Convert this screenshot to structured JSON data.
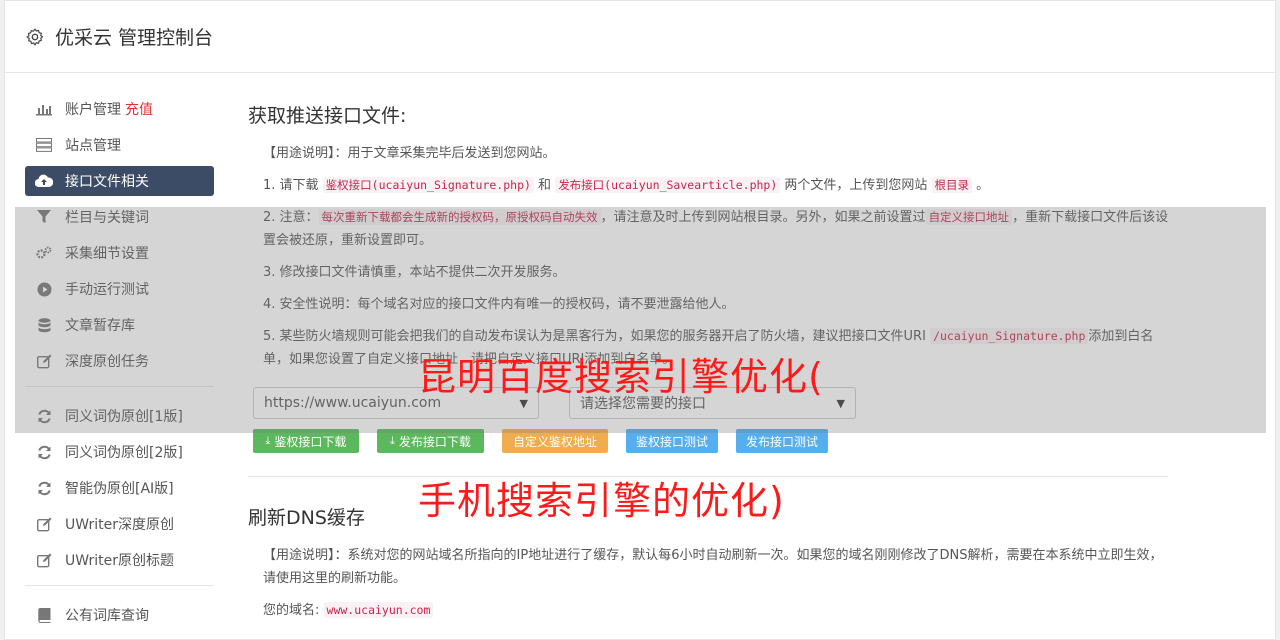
{
  "header": {
    "title": "优采云 管理控制台",
    "icon": "gear-icon"
  },
  "sidebar": {
    "items": [
      {
        "label": "账户管理",
        "badge": "充值",
        "icon": "bar-chart-icon"
      },
      {
        "label": "站点管理",
        "icon": "server-icon"
      },
      {
        "label": "接口文件相关",
        "icon": "cloud-upload-icon",
        "active": true
      },
      {
        "label": "栏目与关键词",
        "icon": "filter-icon"
      },
      {
        "label": "采集细节设置",
        "icon": "cogs-icon"
      },
      {
        "label": "手动运行测试",
        "icon": "play-circle-icon"
      },
      {
        "label": "文章暂存库",
        "icon": "database-icon"
      },
      {
        "label": "深度原创任务",
        "icon": "edit-icon"
      }
    ],
    "items2": [
      {
        "label": "同义词伪原创[1版]",
        "icon": "refresh-icon"
      },
      {
        "label": "同义词伪原创[2版]",
        "icon": "refresh-icon"
      },
      {
        "label": "智能伪原创[AI版]",
        "icon": "refresh-icon"
      },
      {
        "label": "UWriter深度原创",
        "icon": "edit-icon"
      },
      {
        "label": "UWriter原创标题",
        "icon": "edit-icon"
      }
    ],
    "items3": [
      {
        "label": "公有词库查询",
        "icon": "book-icon"
      }
    ]
  },
  "section1": {
    "title": "获取推送接口文件:",
    "usage_label": "【用途说明】",
    "usage_text": "：用于文章采集完毕后发送到您网站。",
    "p1": {
      "a": "1. 请下载 ",
      "code1": "鉴权接口(ucaiyun_Signature.php)",
      "b": " 和 ",
      "code2": "发布接口(ucaiyun_Savearticle.php)",
      "c": " 两个文件，上传到您网站 ",
      "code3": "根目录",
      "d": " 。"
    },
    "p2": {
      "a": "2. 注意：",
      "code1": "每次重新下载都会生成新的授权码，原授权码自动失效",
      "b": "，请注意及时上传到网站根目录。另外，如果之前设置过",
      "code2": "自定义接口地址",
      "c": "，重新下载接口文件后该设置会被还原，重新设置即可。"
    },
    "p3": "3. 修改接口文件请慎重，本站不提供二次开发服务。",
    "p4": "4. 安全性说明：每个域名对应的接口文件内有唯一的授权码，请不要泄露给他人。",
    "p5": {
      "a": "5. 某些防火墙规则可能会把我们的自动发布误认为是黑客行为，如果您的服务器开启了防火墙，建议把接口文件URI ",
      "code1": "/ucaiyun_Signature.php",
      "b": "添加到白名单，如果您设置了自定义接口地址，请把自定义接口URI添加到白名单。"
    },
    "site_select": "https://www.ucaiyun.com",
    "iface_select": "请选择您需要的接口",
    "buttons": {
      "dl_sign": "鉴权接口下载",
      "dl_pub": "发布接口下载",
      "custom": "自定义鉴权地址",
      "test_sign": "鉴权接口测试",
      "test_pub": "发布接口测试"
    }
  },
  "section2": {
    "title": "刷新DNS缓存",
    "usage_label": "【用途说明】",
    "usage_text": "：系统对您的网站域名所指向的IP地址进行了缓存，默认每6小时自动刷新一次。如果您的域名刚刚修改了DNS解析，需要在本系统中立即生效，请使用这里的刷新功能。",
    "domain_label": "您的域名:",
    "domain_value": "www.ucaiyun.com"
  },
  "ad": {
    "line1": "昆明百度搜索引擎优化(",
    "line2": "手机搜索引擎的优化)"
  }
}
